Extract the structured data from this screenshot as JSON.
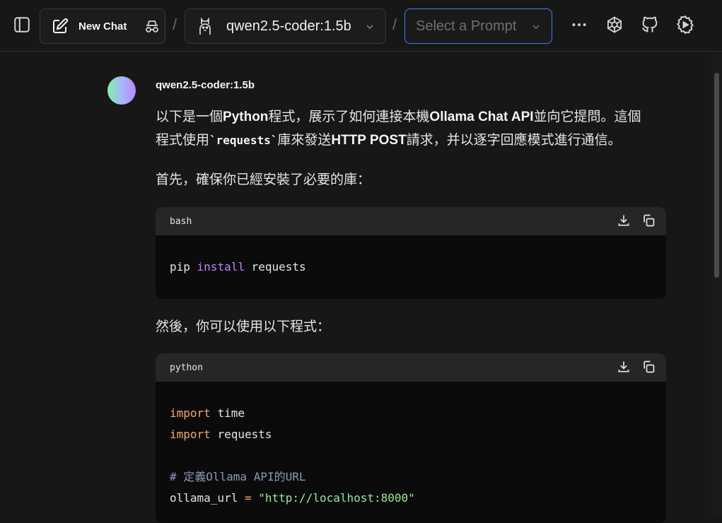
{
  "header": {
    "new_chat_label": "New Chat",
    "separator": "/",
    "model_name": "qwen2.5-coder:1.5b",
    "prompt_placeholder": "Select a Prompt"
  },
  "message": {
    "sender": "qwen2.5-coder:1.5b",
    "para1_line1_a": "以下是一個",
    "para1_line1_b": "Python",
    "para1_line1_c": "程式，展示了如何連接本機",
    "para1_line1_d": "Ollama Chat API",
    "para1_line1_e": "並向它提問。這個",
    "para1_line2_a": "程式使用",
    "para1_line2_code": "`requests`",
    "para1_line2_b": "庫來發送",
    "para1_line2_c": "HTTP POST",
    "para1_line2_d": "請求，并以逐字回應模式進行通信。",
    "para2": "首先，確保你已經安裝了必要的庫：",
    "para3": "然後，你可以使用以下程式：",
    "code1": {
      "lang": "bash",
      "line1_cmd": "pip",
      "line1_kw": "install",
      "line1_arg": "requests"
    },
    "code2": {
      "lang": "python",
      "line1_kw": "import",
      "line1_mod": "time",
      "line2_kw": "import",
      "line2_mod": "requests",
      "line4_comment": "# 定義Ollama API的URL",
      "line5_var": "ollama_url",
      "line5_op": "=",
      "line5_str": "\"http://localhost:8000\""
    }
  },
  "colors": {
    "accent_border": "#3b82f6",
    "background": "#171717",
    "code_bg": "#0b0b0b",
    "code_header_bg": "#262626"
  }
}
